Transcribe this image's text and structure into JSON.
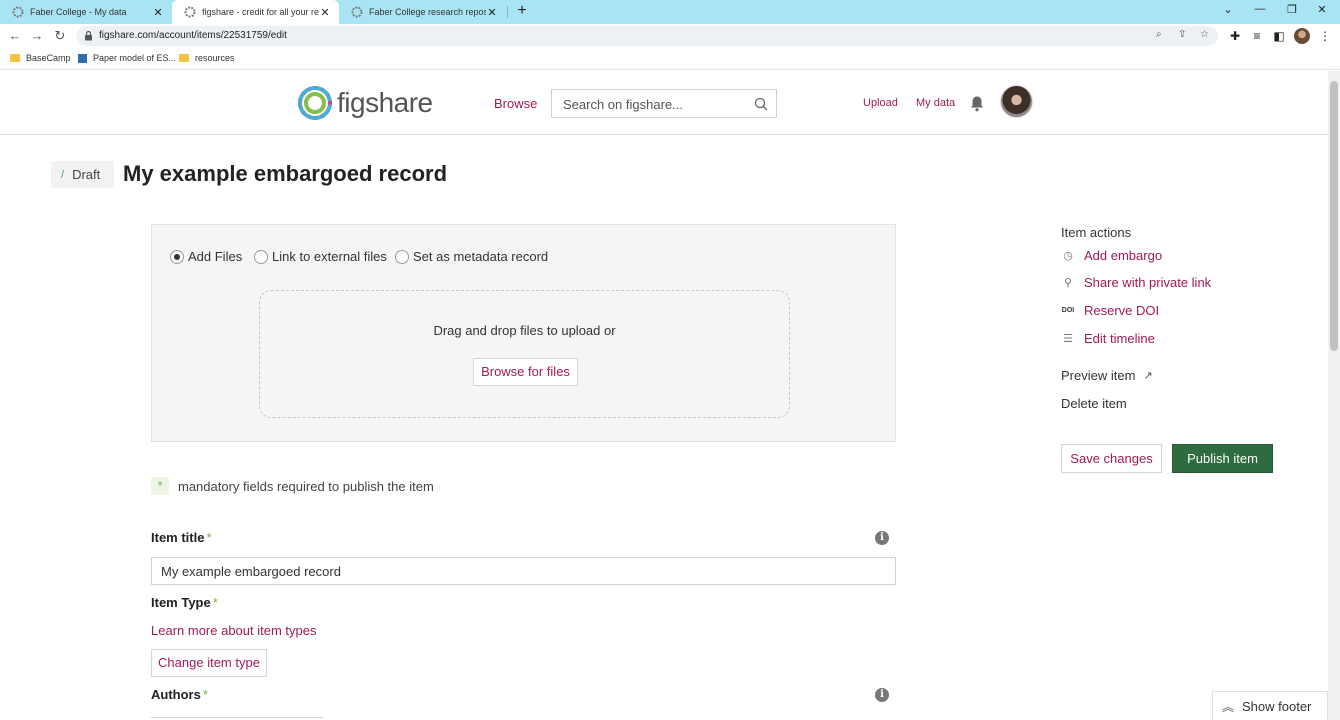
{
  "browser": {
    "tabs": [
      {
        "title": "Faber College - My data",
        "close": "✕"
      },
      {
        "title": "figshare - credit for all your rese",
        "close": "✕"
      },
      {
        "title": "Faber College research reposito",
        "close": "✕"
      }
    ],
    "new_tab": "+",
    "url": "figshare.com/account/items/22531759/edit",
    "bookmarks": [
      "BaseCamp",
      "Paper model of ES...",
      "resources"
    ]
  },
  "header": {
    "logo_text": "figshare",
    "browse": "Browse",
    "search_placeholder": "Search on figshare...",
    "upload": "Upload",
    "my_data": "My data"
  },
  "item": {
    "status": "Draft",
    "title": "My example embargoed record"
  },
  "upload": {
    "options": [
      "Add Files",
      "Link to external files",
      "Set as metadata record"
    ],
    "selected_option": "Add Files",
    "drop_message": "Drag and drop files to upload or",
    "browse_button": "Browse for files"
  },
  "form": {
    "mandatory_star": "*",
    "mandatory_note": "mandatory fields required to publish the item",
    "title_label": "Item title",
    "title_value": "My example embargoed record",
    "type_label": "Item Type",
    "learn_more": "Learn more about item types",
    "change_type": "Change item type",
    "authors_label": "Authors",
    "required_mark": "*",
    "info_glyph": "i"
  },
  "actions": {
    "heading": "Item actions",
    "items": [
      {
        "label": "Add embargo",
        "icon": "timer-icon"
      },
      {
        "label": "Share with private link",
        "icon": "link-icon"
      },
      {
        "label": "Reserve DOI",
        "icon": "doi-icon",
        "icon_text": "DOI"
      },
      {
        "label": "Edit timeline",
        "icon": "list-icon"
      }
    ],
    "preview": "Preview item",
    "delete": "Delete item",
    "save": "Save changes",
    "publish": "Publish item"
  },
  "footer": {
    "show_footer": "Show footer"
  },
  "colors": {
    "tabstrip": "#a9e4f4",
    "accent": "#a31a57",
    "publish": "#2e6b3f",
    "required": "#7cb342"
  }
}
